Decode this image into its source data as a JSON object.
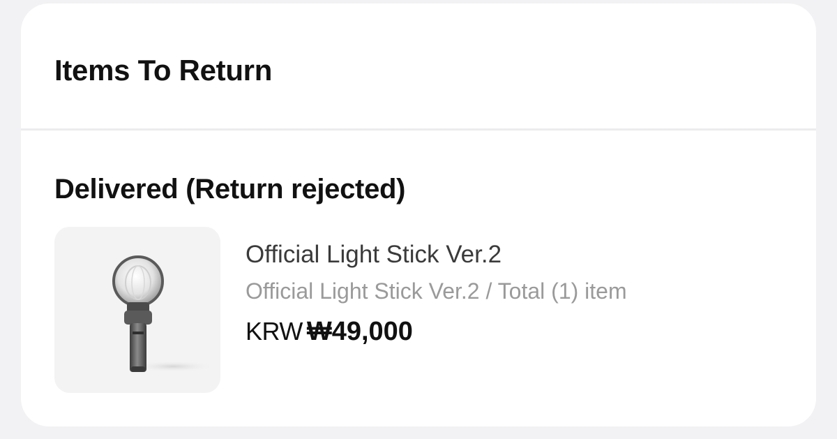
{
  "return_card": {
    "title": "Items To Return",
    "status": "Delivered (Return rejected)",
    "item": {
      "name": "Official Light Stick Ver.2",
      "option": "Official Light Stick Ver.2 / Total (1) item",
      "currency": "KRW",
      "price": "₩49,000",
      "image_icon": "light-stick-icon"
    }
  }
}
